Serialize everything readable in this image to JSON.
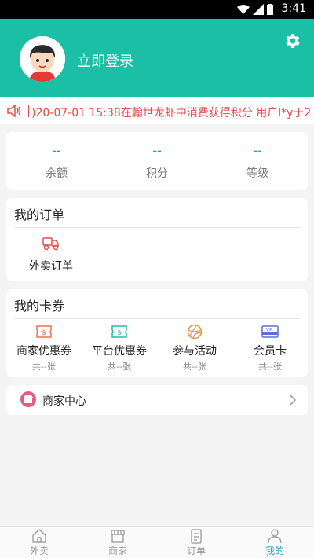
{
  "status_bar": {
    "time": "3:41"
  },
  "header": {
    "login_label": "立即登录",
    "brand_color": "#1bbfa6"
  },
  "ticker": {
    "text": ")20-07-01 15:38在翰世龙虾中消费获得积分  用户l*y于2"
  },
  "stats": [
    {
      "value": "--",
      "label": "余额"
    },
    {
      "value": "--",
      "label": "积分"
    },
    {
      "value": "--",
      "label": "等级"
    }
  ],
  "orders": {
    "title": "我的订单",
    "items": [
      {
        "label": "外卖订单",
        "icon": "delivery-scooter-icon"
      }
    ]
  },
  "coupons": {
    "title": "我的卡券",
    "items": [
      {
        "label": "商家优惠券",
        "sub": "共--张",
        "icon": "merchant-coupon-icon"
      },
      {
        "label": "平台优惠券",
        "sub": "共--张",
        "icon": "platform-coupon-icon"
      },
      {
        "label": "参与活动",
        "sub": "共--张",
        "icon": "activity-icon"
      },
      {
        "label": "会员卡",
        "sub": "共--张",
        "icon": "vip-card-icon"
      }
    ]
  },
  "merchant_center": {
    "label": "商家中心"
  },
  "tabbar": [
    {
      "label": "外卖",
      "icon": "home-icon",
      "active": false
    },
    {
      "label": "商家",
      "icon": "store-icon",
      "active": false
    },
    {
      "label": "订单",
      "icon": "order-clipboard-icon",
      "active": false
    },
    {
      "label": "我的",
      "icon": "profile-icon",
      "active": true
    }
  ],
  "colors": {
    "accent": "#1a9ec8",
    "ticker": "#e24c4c",
    "header": "#1bbfa6"
  }
}
